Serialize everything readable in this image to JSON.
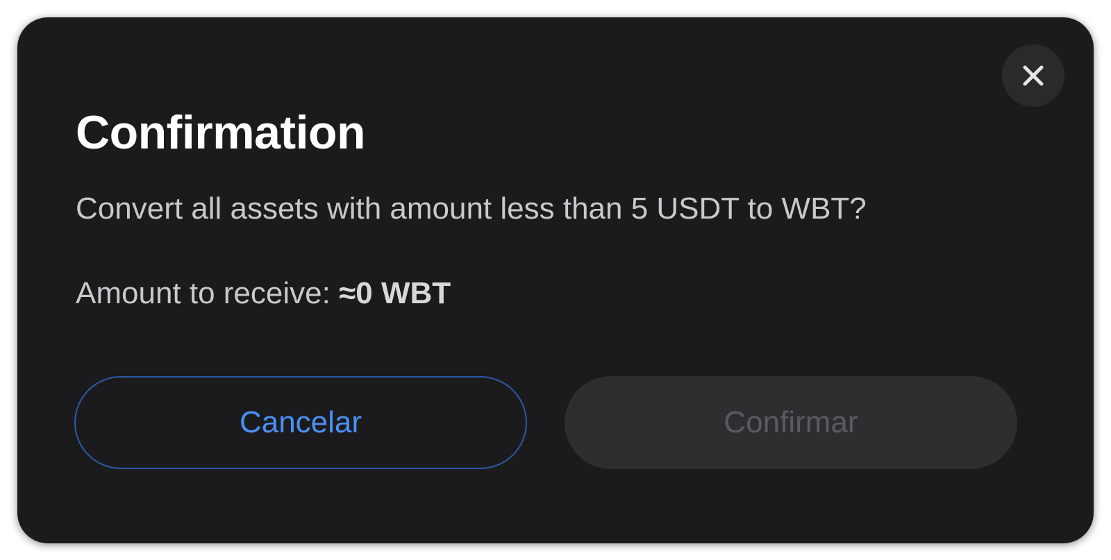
{
  "dialog": {
    "title": "Confirmation",
    "message": "Convert all assets with amount less than 5 USDT to WBT?",
    "amount_label": "Amount to receive:",
    "amount_value": "≈0 WBT",
    "close_icon": "close-icon",
    "cancel_label": "Cancelar",
    "confirm_label": "Confirmar",
    "confirm_disabled": true
  },
  "colors": {
    "background": "#1b1b1d",
    "accent": "#4a90f5",
    "cancel_border": "#2c5aa8",
    "disabled_bg": "#2e2e31",
    "disabled_text": "#5b5b5f"
  }
}
